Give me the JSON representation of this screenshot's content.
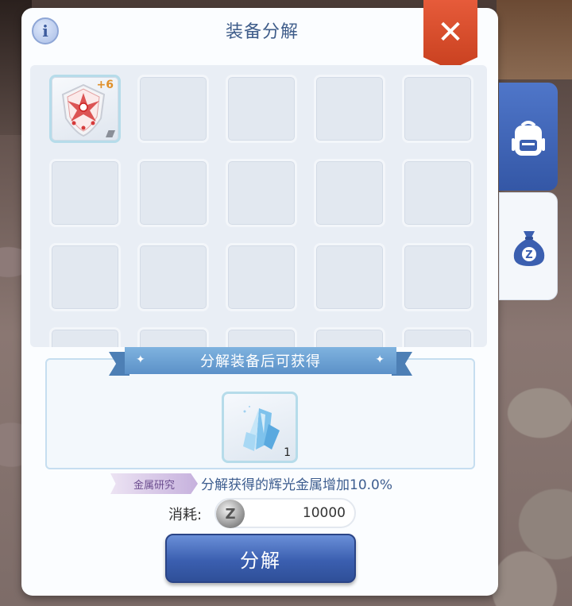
{
  "window": {
    "title": "装备分解"
  },
  "info_button": {
    "label": "i"
  },
  "close_button": {
    "label": "✕"
  },
  "equipment_grid": {
    "rows": 4,
    "columns": 5,
    "slots": [
      {
        "item": "shield",
        "refine": "+6"
      }
    ]
  },
  "side_tabs": [
    {
      "icon": "backpack-icon",
      "active": true
    },
    {
      "icon": "zeny-bag-icon",
      "active": false
    }
  ],
  "reward": {
    "header": "分解装备后可获得",
    "item": {
      "icon": "crystal-icon",
      "count": "1"
    }
  },
  "bonus": {
    "tag": "金属研究",
    "text": "分解获得的辉光金属增加10.0%"
  },
  "cost": {
    "label": "消耗:",
    "currency_icon": "Z",
    "value": "10000"
  },
  "action": {
    "label": "分解"
  },
  "colors": {
    "accent": "#3b5fb0",
    "close": "#d84a28",
    "panel": "#fbfdff"
  }
}
